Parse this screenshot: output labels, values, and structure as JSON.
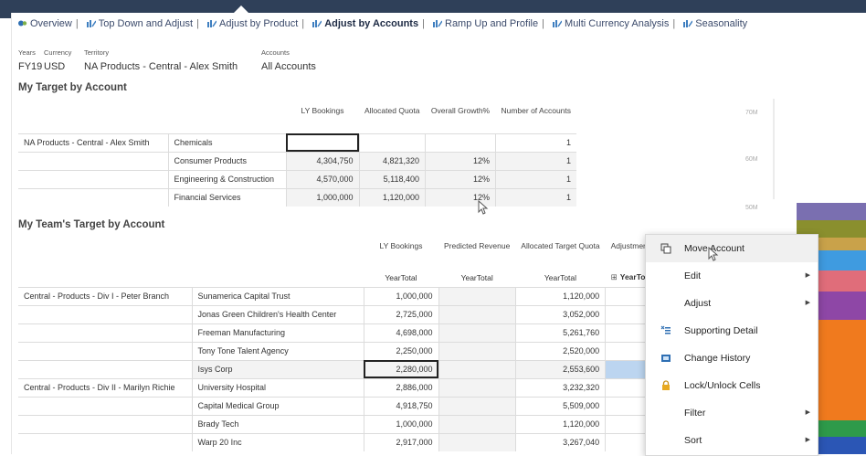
{
  "nav": {
    "tabs": [
      {
        "label": "Overview",
        "active": false
      },
      {
        "label": "Top Down and Adjust",
        "active": false
      },
      {
        "label": "Adjust by Product",
        "active": false
      },
      {
        "label": "Adjust by Accounts",
        "active": true
      },
      {
        "label": "Ramp Up and Profile",
        "active": false
      },
      {
        "label": "Multi Currency Analysis",
        "active": false
      },
      {
        "label": "Seasonality",
        "active": false
      }
    ]
  },
  "pov": {
    "years": {
      "caption": "Years",
      "value": "FY19"
    },
    "currency": {
      "caption": "Currency",
      "value": "USD"
    },
    "territory": {
      "caption": "Territory",
      "value": "NA Products - Central - Alex Smith"
    },
    "accounts": {
      "caption": "Accounts",
      "value": "All Accounts"
    }
  },
  "section1": {
    "title": "My Target by Account",
    "headers": [
      "LY Bookings",
      "Allocated Quota",
      "Overall Growth%",
      "Number of Accounts"
    ],
    "territory": "NA Products - Central - Alex Smith",
    "rows": [
      {
        "name": "Chemicals",
        "ly": "",
        "alloc": "",
        "growth": "",
        "num": "1"
      },
      {
        "name": "Consumer Products",
        "ly": "4,304,750",
        "alloc": "4,821,320",
        "growth": "12%",
        "num": "1"
      },
      {
        "name": "Engineering & Construction",
        "ly": "4,570,000",
        "alloc": "5,118,400",
        "growth": "12%",
        "num": "1"
      },
      {
        "name": "Financial Services",
        "ly": "1,000,000",
        "alloc": "1,120,000",
        "growth": "12%",
        "num": "1"
      }
    ]
  },
  "section2": {
    "title": "My Team's Target by Account",
    "headers": [
      "LY Bookings",
      "Predicted Revenue",
      "Allocated Target Quota",
      "Adjustment Value"
    ],
    "subheaders": [
      "YearTotal",
      "YearTotal",
      "YearTotal",
      "YearTotal"
    ],
    "rows": [
      {
        "member": "Central - Products - Div I - Peter Branch",
        "name": "Sunamerica Capital Trust",
        "ly": "1,000,000",
        "pred": "",
        "alloc": "1,120,000"
      },
      {
        "member": "",
        "name": "Jonas Green Children's Health Center",
        "ly": "2,725,000",
        "pred": "",
        "alloc": "3,052,000"
      },
      {
        "member": "",
        "name": "Freeman Manufacturing",
        "ly": "4,698,000",
        "pred": "",
        "alloc": "5,261,760"
      },
      {
        "member": "",
        "name": "Tony Tone Talent Agency",
        "ly": "2,250,000",
        "pred": "",
        "alloc": "2,520,000"
      },
      {
        "member": "",
        "name": "Isys Corp",
        "ly": "2,280,000",
        "pred": "",
        "alloc": "2,553,600"
      },
      {
        "member": "Central - Products - Div II - Marilyn Richie",
        "name": "University Hospital",
        "ly": "2,886,000",
        "pred": "",
        "alloc": "3,232,320"
      },
      {
        "member": "",
        "name": "Capital Medical Group",
        "ly": "4,918,750",
        "pred": "",
        "alloc": "5,509,000"
      },
      {
        "member": "",
        "name": "Brady Tech",
        "ly": "1,000,000",
        "pred": "",
        "alloc": "1,120,000"
      },
      {
        "member": "",
        "name": "Warp 20 Inc",
        "ly": "2,917,000",
        "pred": "",
        "alloc": "3,267,040"
      }
    ]
  },
  "axis": {
    "ticks": [
      "70M",
      "60M",
      "50M"
    ]
  },
  "context_menu": {
    "items": [
      {
        "label": "Move Account",
        "icon": "move-account-icon",
        "submenu": false
      },
      {
        "label": "Edit",
        "icon": "",
        "submenu": true
      },
      {
        "label": "Adjust",
        "icon": "",
        "submenu": true
      },
      {
        "label": "Supporting Detail",
        "icon": "supporting-detail-icon",
        "submenu": false
      },
      {
        "label": "Change History",
        "icon": "change-history-icon",
        "submenu": false
      },
      {
        "label": "Lock/Unlock Cells",
        "icon": "lock-icon",
        "submenu": false
      },
      {
        "label": "Filter",
        "icon": "",
        "submenu": true
      },
      {
        "label": "Sort",
        "icon": "",
        "submenu": true
      }
    ]
  },
  "colors": {
    "header_bar": "#2f4059",
    "selection": "#bcd5f0",
    "bar_colors": [
      "#7a6fb0",
      "#8a8f2e",
      "#3f9be0",
      "#e06d7a",
      "#8e47a6",
      "#f07a1e",
      "#2e9a4a",
      "#2b56b5"
    ]
  }
}
